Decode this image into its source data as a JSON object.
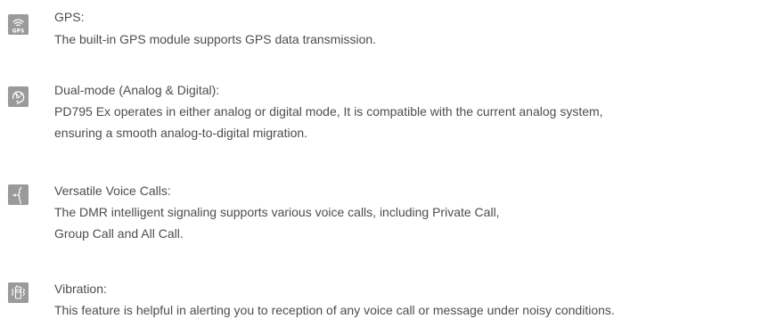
{
  "features": [
    {
      "icon": "gps-icon",
      "title": "GPS:",
      "lines": [
        "The built-in GPS module supports GPS data transmission."
      ]
    },
    {
      "icon": "dual-mode-icon",
      "title": "Dual-mode (Analog & Digital):",
      "lines": [
        "PD795 Ex operates in either analog or digital mode,  It is compatible with the current analog system,",
        "ensuring a smooth analog-to-digital migration."
      ]
    },
    {
      "icon": "voice-call-icon",
      "title": "Versatile Voice Calls:",
      "lines": [
        "The DMR intelligent signaling supports various voice calls, including Private Call,",
        "Group Call and All Call."
      ]
    },
    {
      "icon": "vibration-icon",
      "title": "Vibration:",
      "lines": [
        "This feature is helpful in alerting you to reception of any voice call or message under noisy conditions."
      ]
    }
  ],
  "colors": {
    "icon_bg": "#9a9a9a",
    "icon_fg": "#ffffff",
    "text": "#4d4d4d"
  }
}
